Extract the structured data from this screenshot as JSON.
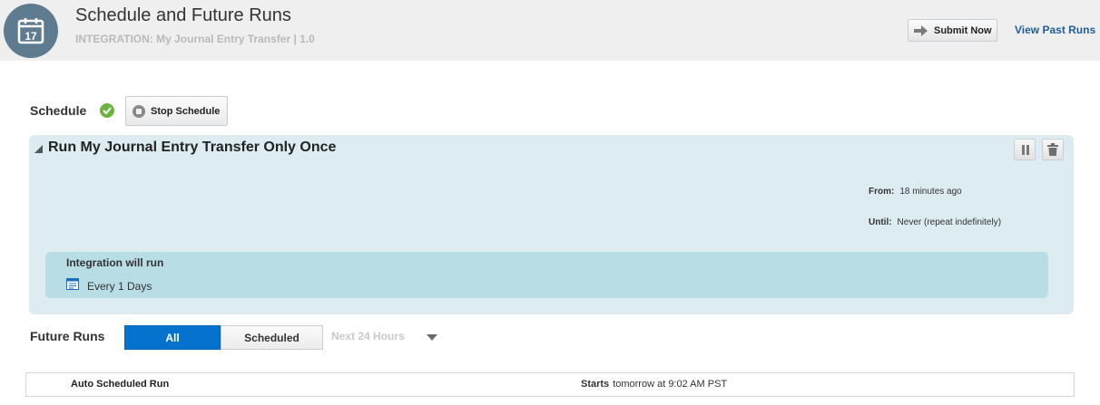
{
  "header": {
    "icon": "calendar-icon",
    "calendar_day": "17",
    "title": "Schedule and Future Runs",
    "subtitle": "INTEGRATION: My Journal Entry Transfer | 1.0",
    "submit_label": "Submit Now",
    "past_runs_label": "View Past Runs"
  },
  "schedule": {
    "label": "Schedule",
    "status_icon": "check-circle-icon",
    "stop_label": "Stop Schedule"
  },
  "panel": {
    "title": "Run My Journal Entry Transfer Only Once",
    "from_label": "From:",
    "from_value": "18 minutes ago",
    "until_label": "Until:",
    "until_value": "Never (repeat indefinitely)",
    "run_title": "Integration will run",
    "run_frequency": "Every 1 Days"
  },
  "future_runs": {
    "label": "Future Runs",
    "filters": [
      "All",
      "Scheduled"
    ],
    "selected_filter": "All",
    "range": "Next 24 Hours",
    "rows": [
      {
        "name": "Auto Scheduled Run",
        "starts_label": "Starts",
        "starts_value": "tomorrow at 9:02 AM PST"
      }
    ]
  },
  "colors": {
    "header_bg": "#efefef",
    "panel_bg": "#ddecf1",
    "run_box_bg": "#b8dde5",
    "accent_blue": "#0572ce",
    "link": "#1f5f96",
    "success": "#6cb33f"
  }
}
